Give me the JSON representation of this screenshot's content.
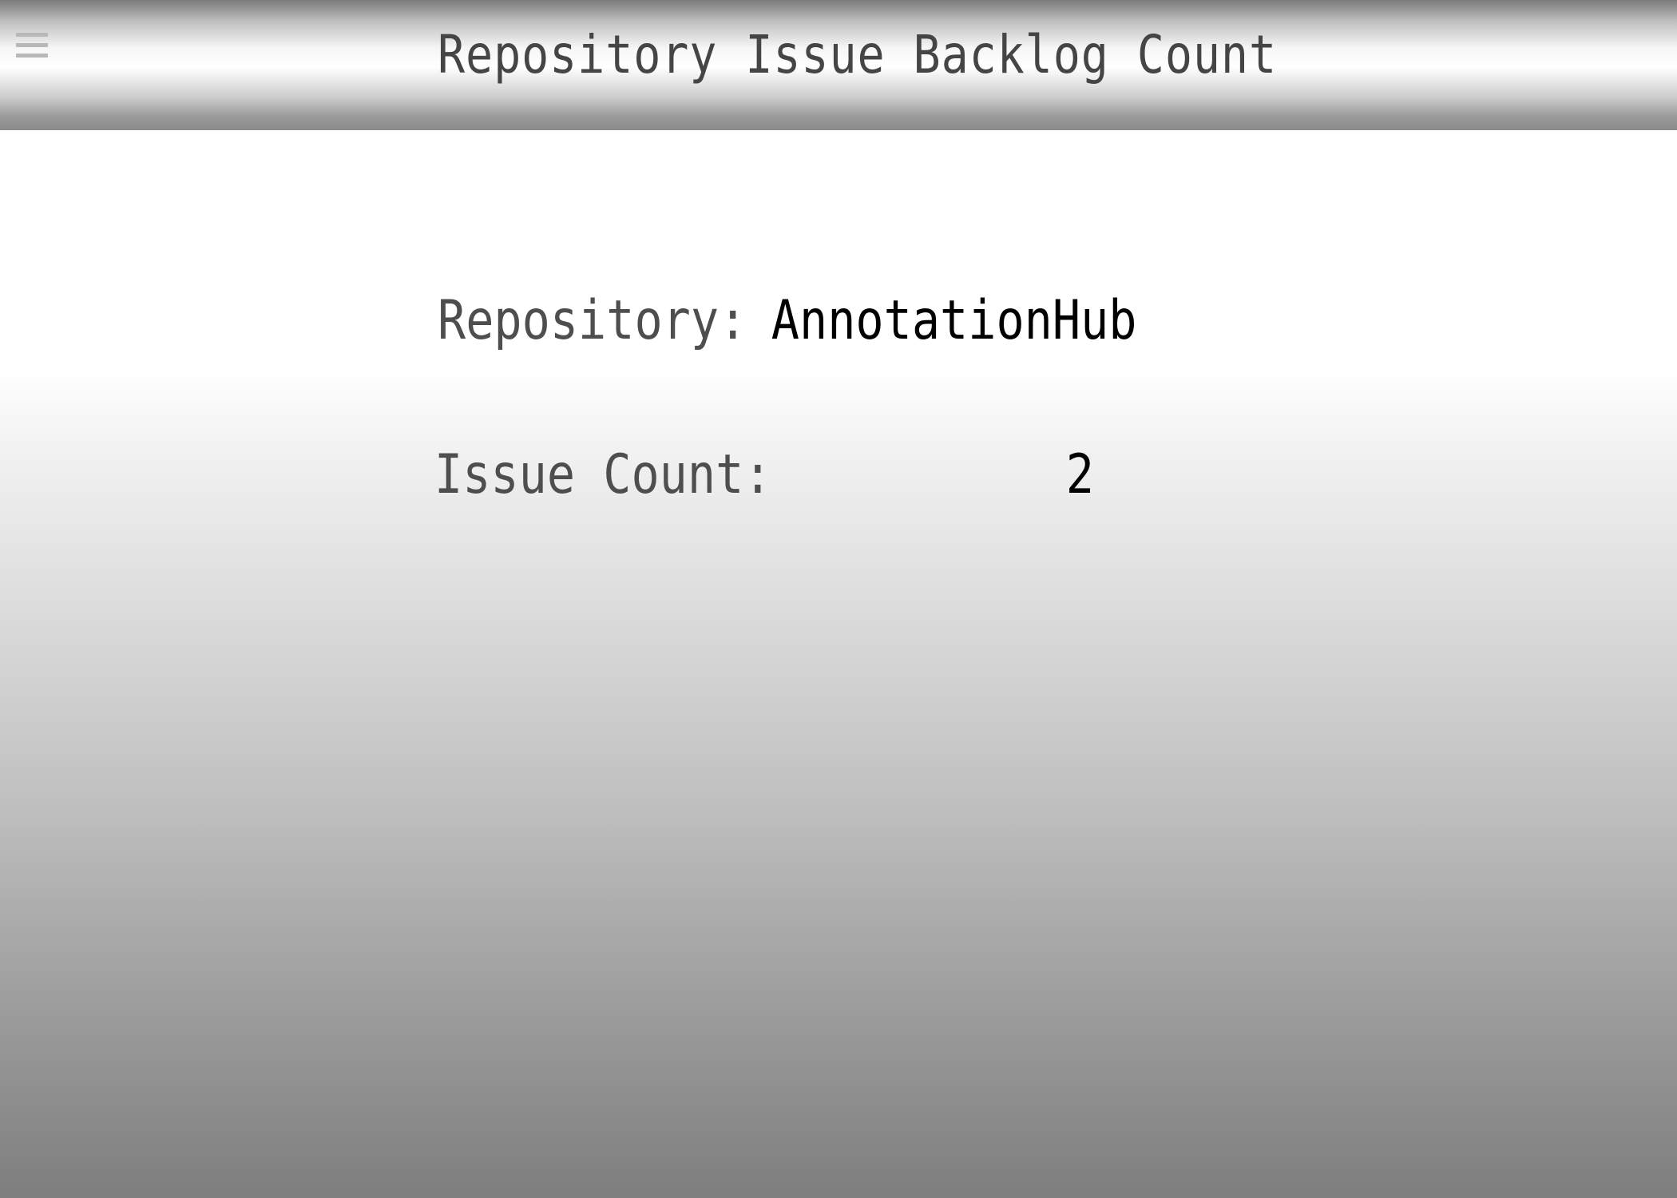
{
  "header": {
    "title": "Repository Issue Backlog Count",
    "menu_icon": "hamburger-menu-icon"
  },
  "details": {
    "repository_label": "Repository:",
    "repository_value": "AnnotationHub",
    "issue_count_label": "Issue Count:",
    "issue_count_value": "2"
  },
  "colors": {
    "header_band": "#8a8a8a",
    "text_label": "#4e4e4e",
    "text_value": "#000000"
  }
}
